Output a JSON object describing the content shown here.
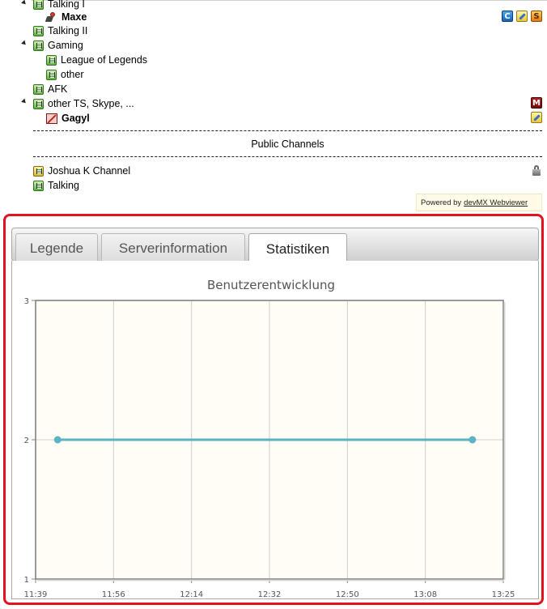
{
  "tree": {
    "rows": [
      {
        "label": "Talking I",
        "type": "channel"
      },
      {
        "label": "Maxe",
        "type": "user"
      },
      {
        "label": "Talking II",
        "type": "channel"
      },
      {
        "label": "Gaming",
        "type": "channel"
      },
      {
        "label": "League of Legends",
        "type": "channel"
      },
      {
        "label": "other",
        "type": "channel"
      },
      {
        "label": "AFK",
        "type": "channel"
      },
      {
        "label": "other TS, Skype, ...",
        "type": "channel"
      },
      {
        "label": "Gagyl",
        "type": "user"
      },
      {
        "label": "Joshua K Channel",
        "type": "channel-locked"
      },
      {
        "label": "Talking",
        "type": "channel"
      }
    ],
    "badges": {
      "maxe": [
        "C",
        "pencil",
        "S"
      ],
      "other_ts": [
        "M"
      ],
      "gagyl": [
        "pencil"
      ],
      "joshua": [
        "lock"
      ]
    },
    "spacer_label": "Public Channels"
  },
  "powered_by": {
    "prefix": "Powered by",
    "link": "devMX Webviewer"
  },
  "tabs": [
    {
      "label": "Legende",
      "active": false
    },
    {
      "label": "Serverinformation",
      "active": false
    },
    {
      "label": "Statistiken",
      "active": true
    }
  ],
  "colors": {
    "frame": "#e0141e",
    "series": "#5ab4c4",
    "plot_bg": "#fffdf5"
  },
  "chart_data": {
    "type": "line",
    "title": "Benutzerentwicklung",
    "x_ticks": [
      "11:39",
      "11:56",
      "12:14",
      "12:32",
      "12:50",
      "13:08",
      "13:25"
    ],
    "y_ticks": [
      "1",
      "2",
      "3"
    ],
    "ylim": [
      1,
      3
    ],
    "xlim": [
      "11:39",
      "13:25"
    ],
    "grid": true,
    "series": [
      {
        "x": [
          "11:44",
          "13:18"
        ],
        "y": [
          2,
          2
        ]
      }
    ]
  }
}
